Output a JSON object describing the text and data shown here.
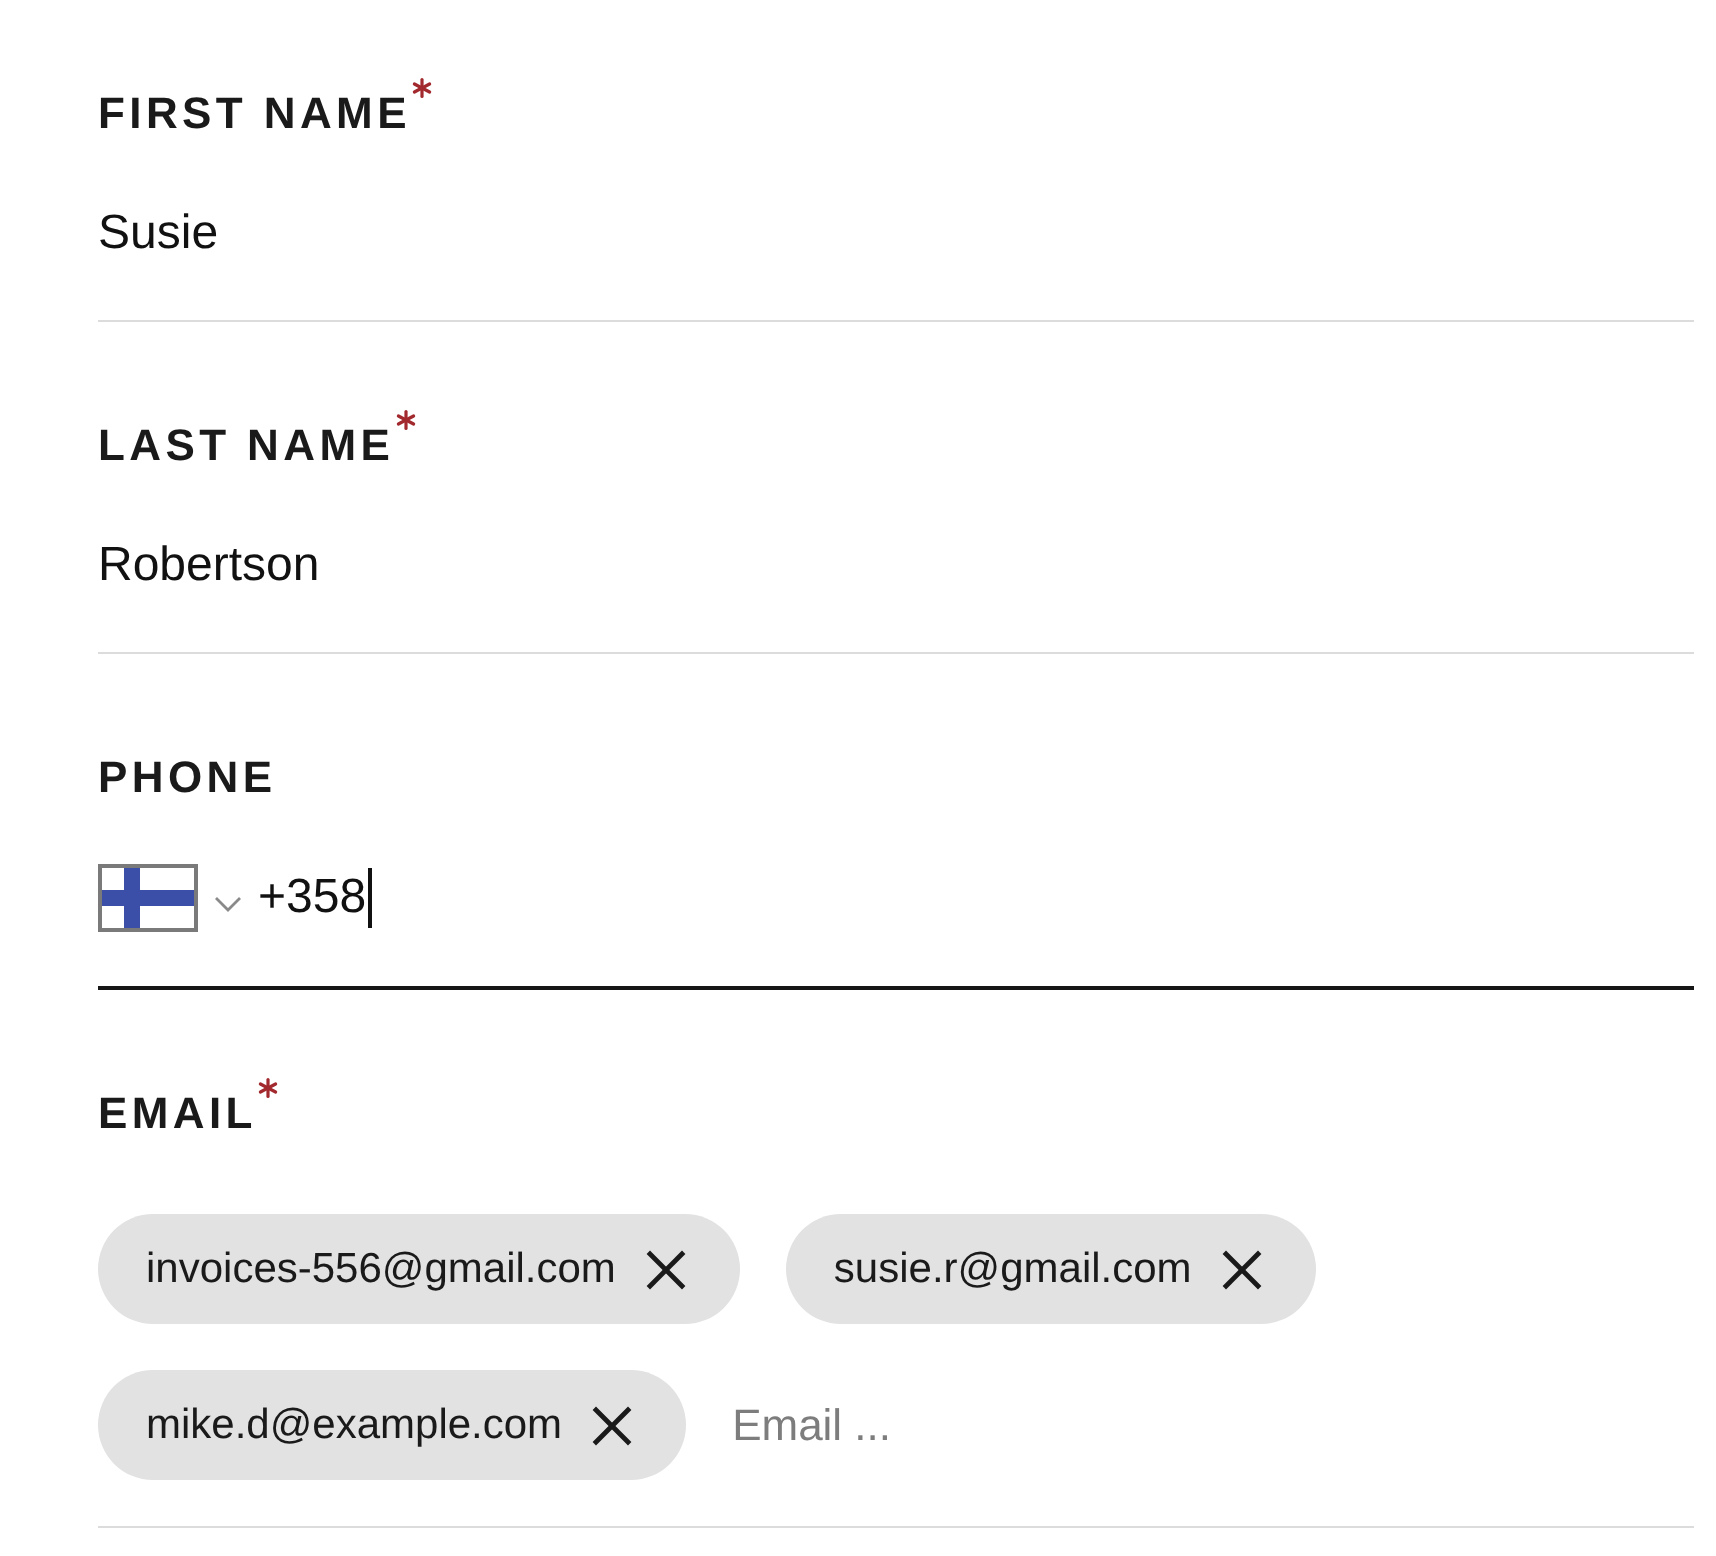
{
  "fields": [
    {
      "kind": "text",
      "label": "FIRST NAME",
      "required": true,
      "focused": false,
      "value": "Susie"
    },
    {
      "kind": "text",
      "label": "LAST NAME",
      "required": true,
      "focused": false,
      "value": "Robertson"
    },
    {
      "kind": "phone",
      "label": "PHONE",
      "required": false,
      "focused": true,
      "value": "+358"
    },
    {
      "kind": "tags",
      "label": "EMAIL",
      "required": true,
      "focused": false,
      "tags": [
        {
          "label": "invoices-556@gmail.com"
        },
        {
          "label": "susie.r@gmail.com"
        },
        {
          "label": "mike.d@example.com"
        }
      ],
      "placeholder": "Email ..."
    }
  ]
}
